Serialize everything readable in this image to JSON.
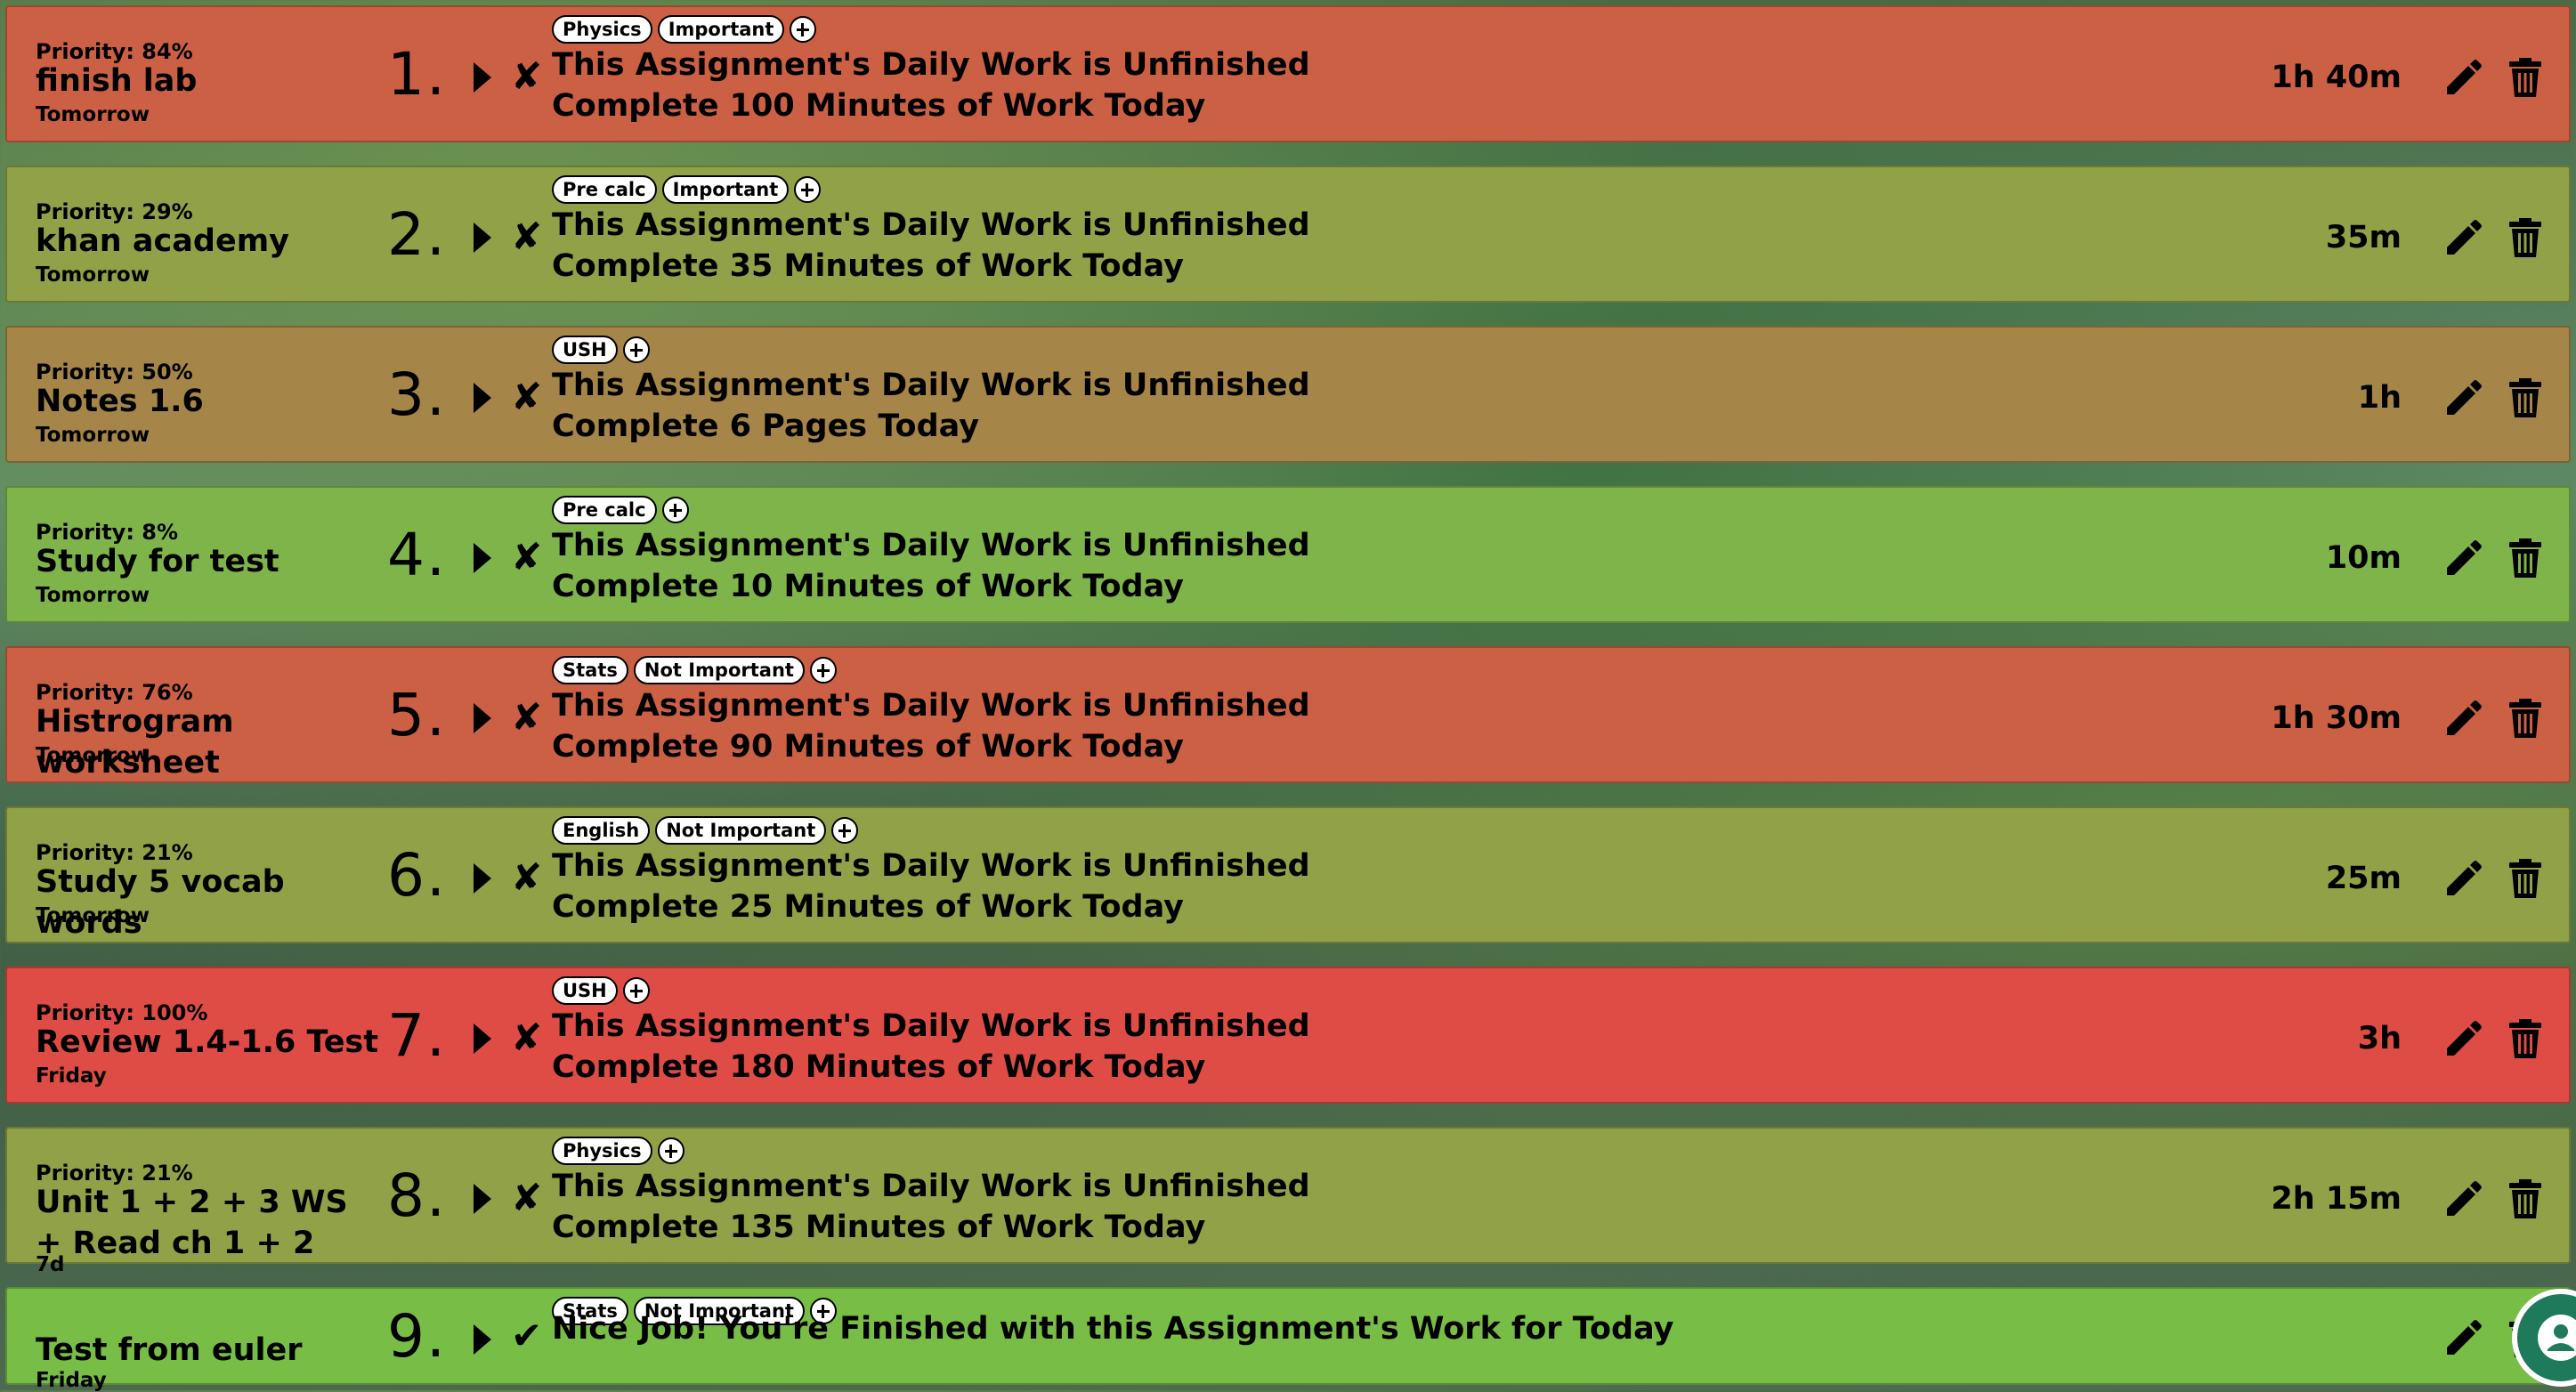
{
  "colors": {
    "red": "#de4c45",
    "salmon": "#cc6045",
    "olive": "#91a148",
    "tan": "#a58548",
    "green": "#7fb44a",
    "brightgreen": "#78be46"
  },
  "assignments": [
    {
      "num": "1.",
      "priority": "Priority: 84%",
      "name": "finish lab",
      "due": "Tomorrow",
      "tags": [
        "Physics",
        "Important"
      ],
      "status": "This Assignment's Daily Work is Unfinished",
      "todo": "Complete 100 Minutes of Work Today",
      "time": "1h 40m",
      "mark": "✘",
      "color": "salmon"
    },
    {
      "num": "2.",
      "priority": "Priority: 29%",
      "name": "khan academy",
      "due": "Tomorrow",
      "tags": [
        "Pre calc",
        "Important"
      ],
      "status": "This Assignment's Daily Work is Unfinished",
      "todo": "Complete 35 Minutes of Work Today",
      "time": "35m",
      "mark": "✘",
      "color": "olive"
    },
    {
      "num": "3.",
      "priority": "Priority: 50%",
      "name": "Notes 1.6",
      "due": "Tomorrow",
      "tags": [
        "USH"
      ],
      "status": "This Assignment's Daily Work is Unfinished",
      "todo": "Complete 6 Pages Today",
      "time": "1h",
      "mark": "✘",
      "color": "tan"
    },
    {
      "num": "4.",
      "priority": "Priority: 8%",
      "name": "Study for test",
      "due": "Tomorrow",
      "tags": [
        "Pre calc"
      ],
      "status": "This Assignment's Daily Work is Unfinished",
      "todo": "Complete 10 Minutes of Work Today",
      "time": "10m",
      "mark": "✘",
      "color": "green"
    },
    {
      "num": "5.",
      "priority": "Priority: 76%",
      "name": "Histrogram worksheet",
      "due": "Tomorrow",
      "tags": [
        "Stats",
        "Not Important"
      ],
      "status": "This Assignment's Daily Work is Unfinished",
      "todo": "Complete 90 Minutes of Work Today",
      "time": "1h 30m",
      "mark": "✘",
      "color": "salmon"
    },
    {
      "num": "6.",
      "priority": "Priority: 21%",
      "name": "Study 5 vocab words",
      "due": "Tomorrow",
      "tags": [
        "English",
        "Not Important"
      ],
      "status": "This Assignment's Daily Work is Unfinished",
      "todo": "Complete 25 Minutes of Work Today",
      "time": "25m",
      "mark": "✘",
      "color": "olive"
    },
    {
      "num": "7.",
      "priority": "Priority: 100%",
      "name": "Review 1.4-1.6 Test",
      "due": "Friday",
      "tags": [
        "USH"
      ],
      "status": "This Assignment's Daily Work is Unfinished",
      "todo": "Complete 180 Minutes of Work Today",
      "time": "3h",
      "mark": "✘",
      "color": "red"
    },
    {
      "num": "8.",
      "priority": "Priority: 21%",
      "name": "Unit 1 + 2 + 3 WS + Read ch 1 + 2",
      "due": "7d",
      "tags": [
        "Physics"
      ],
      "status": "This Assignment's Daily Work is Unfinished",
      "todo": "Complete 135 Minutes of Work Today",
      "time": "2h 15m",
      "mark": "✘",
      "color": "olive"
    },
    {
      "num": "9.",
      "priority": "",
      "name": "Test from euler",
      "due": "Friday",
      "tags": [
        "Stats",
        "Not Important"
      ],
      "status": "Nice Job! You're Finished with this Assignment's Work for Today",
      "todo": "",
      "time": "",
      "mark": "✔",
      "color": "brightgreen"
    }
  ],
  "icons": {
    "expand": "triangle-right-icon",
    "edit": "pencil-icon",
    "delete": "trash-icon",
    "add_tag": "plus-circle-icon",
    "account": "user-icon"
  }
}
